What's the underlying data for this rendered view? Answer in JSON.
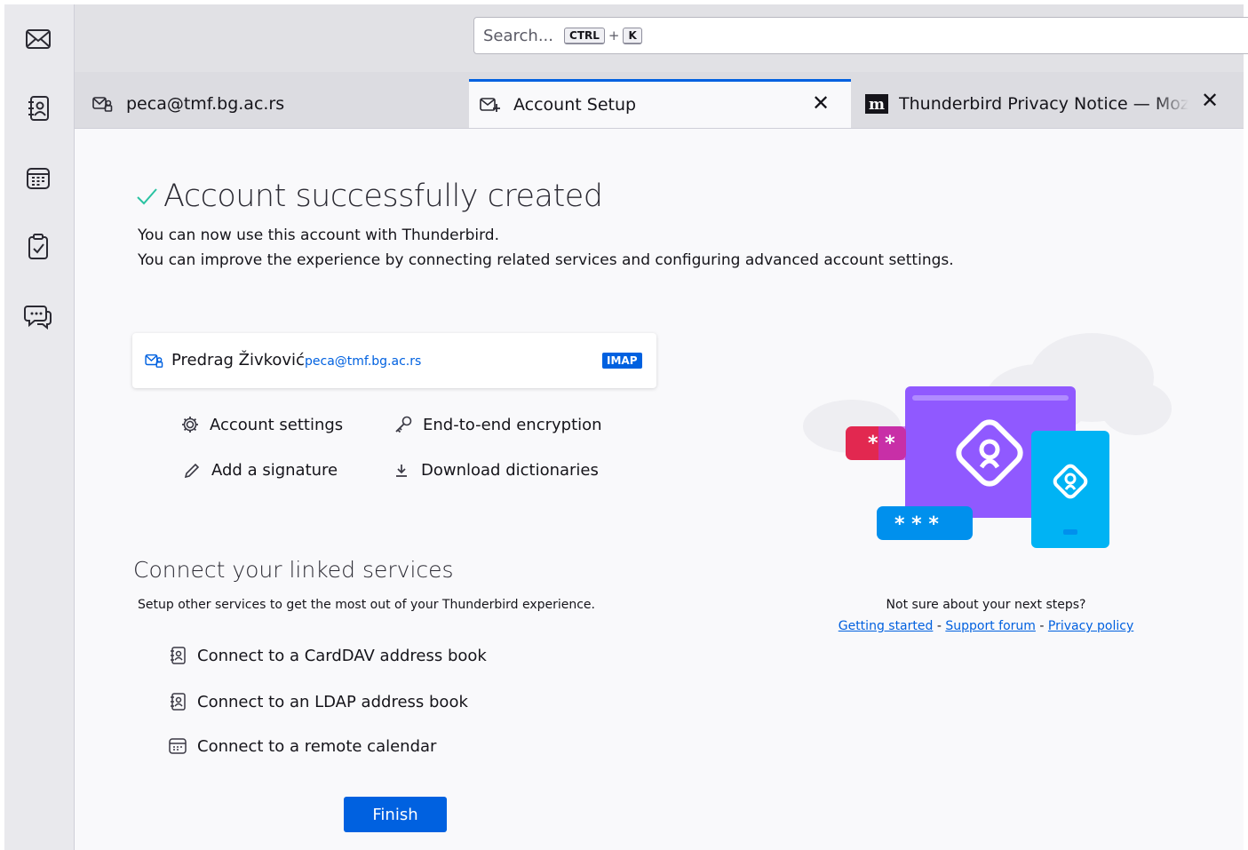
{
  "search": {
    "placeholder": "Search...",
    "key_ctrl": "CTRL",
    "plus": "+",
    "key_k": "K"
  },
  "spaces": [
    "mail-icon",
    "address-book-icon",
    "calendar-icon",
    "tasks-icon",
    "chat-icon"
  ],
  "tabs": [
    {
      "label": "peca@tmf.bg.ac.rs",
      "icon": "mail-account-icon",
      "active": false
    },
    {
      "label": "Account Setup",
      "icon": "account-setup-icon",
      "active": true
    },
    {
      "label": "Thunderbird Privacy Notice — Mozi",
      "icon": "mozilla-m-icon",
      "active": false
    }
  ],
  "main": {
    "title": "Account successfully created",
    "line1": "You can now use this account with Thunderbird.",
    "line2": "You can improve the experience by connecting related services and configuring advanced account settings.",
    "account": {
      "name": "Predrag Živković",
      "email": "peca@tmf.bg.ac.rs",
      "type": "IMAP"
    },
    "options": {
      "account_settings": "Account settings",
      "e2e": "End-to-end encryption",
      "signature": "Add a signature",
      "dictionaries": "Download dictionaries"
    },
    "linked_title": "Connect your linked services",
    "linked_desc": "Setup other services to get the most out of your Thunderbird experience.",
    "linked": {
      "carddav": "Connect to a CardDAV address book",
      "ldap": "Connect to an LDAP address book",
      "calendar": "Connect to a remote calendar"
    },
    "finish": "Finish"
  },
  "help": {
    "question": "Not sure about your next steps?",
    "getting_started": "Getting started",
    "sep": "-",
    "support_forum": "Support forum",
    "privacy_policy": "Privacy policy"
  },
  "illustration": {
    "stars_small": "* *",
    "stars_large": "* * *"
  },
  "colors": {
    "accent": "#0061e0",
    "success": "#2ac3a2",
    "purple": "#9059ff",
    "cyan": "#00b3f4",
    "pink": "#e22850"
  }
}
